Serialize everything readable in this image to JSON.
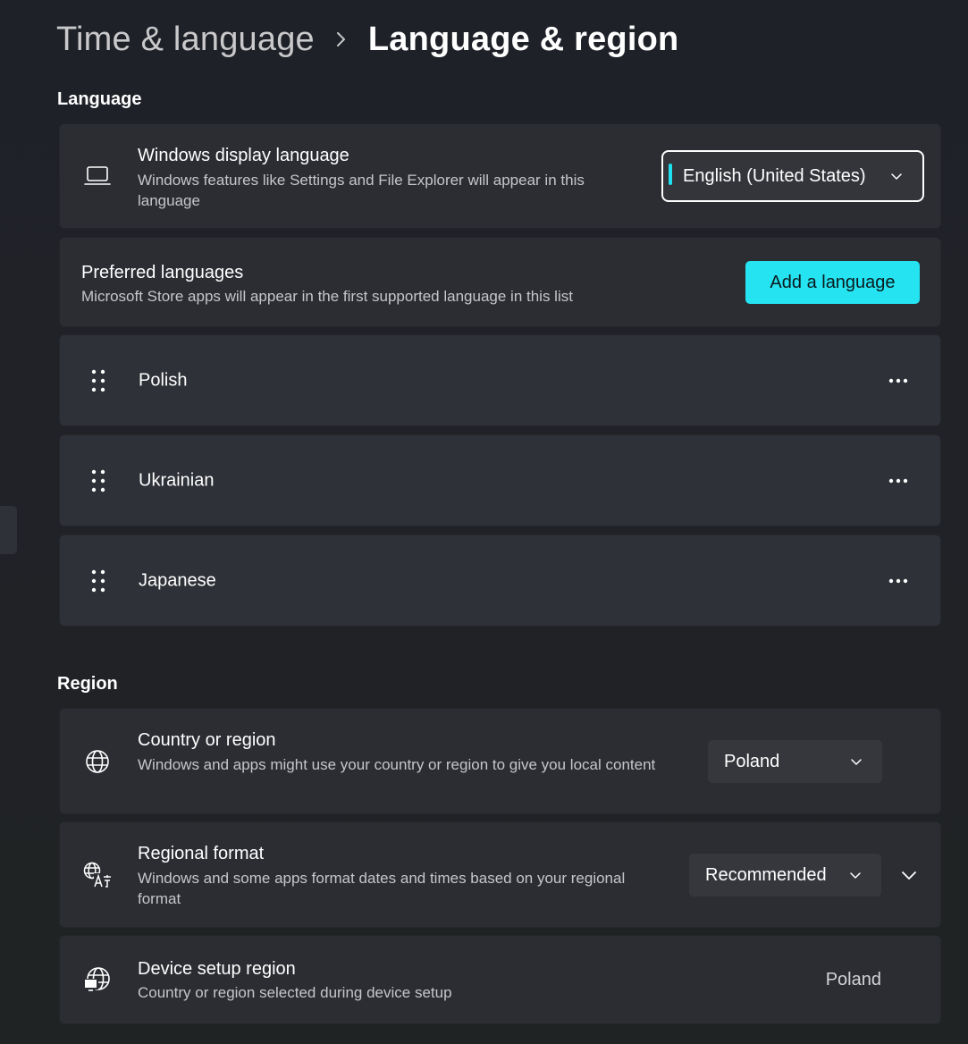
{
  "breadcrumb": {
    "parent": "Time & language",
    "current": "Language & region"
  },
  "language_section": {
    "title": "Language",
    "display_language": {
      "icon": "laptop-icon",
      "title": "Windows display language",
      "description": "Windows features like Settings and File Explorer will appear in this language",
      "selected": "English (United States)"
    },
    "preferred": {
      "title": "Preferred languages",
      "description": "Microsoft Store apps will appear in the first supported language in this list",
      "add_button": "Add a language"
    },
    "languages": [
      {
        "name": "Polish"
      },
      {
        "name": "Ukrainian"
      },
      {
        "name": "Japanese"
      }
    ]
  },
  "region_section": {
    "title": "Region",
    "country": {
      "icon": "globe-icon",
      "title": "Country or region",
      "description": "Windows and apps might use your country or region to give you local content",
      "selected": "Poland"
    },
    "regional_format": {
      "icon": "language-format-icon",
      "title": "Regional format",
      "description": "Windows and some apps format dates and times based on your regional format",
      "selected": "Recommended"
    },
    "device_setup": {
      "icon": "globe-device-icon",
      "title": "Device setup region",
      "description": "Country or region selected during device setup",
      "value": "Poland"
    }
  },
  "colors": {
    "accent": "#25e3f1",
    "card": "#2b2d33",
    "background": "#202227"
  }
}
